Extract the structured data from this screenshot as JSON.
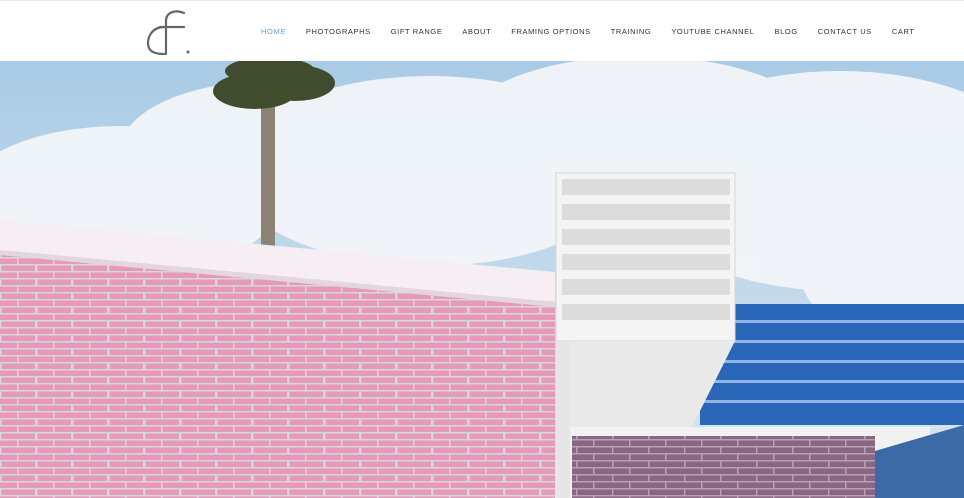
{
  "brand": {
    "logo_text": "cf"
  },
  "nav": {
    "items": [
      {
        "label": "HOME",
        "active": true
      },
      {
        "label": "PHOTOGRAPHS"
      },
      {
        "label": "GIFT RANGE"
      },
      {
        "label": "ABOUT"
      },
      {
        "label": "FRAMING OPTIONS"
      },
      {
        "label": "TRAINING"
      },
      {
        "label": "YOUTUBE CHANNEL"
      },
      {
        "label": "BLOG"
      },
      {
        "label": "CONTACT US"
      },
      {
        "label": "CART"
      }
    ]
  },
  "colors": {
    "nav_active": "#5aa7d1",
    "sky": "#c7dbe9",
    "brick": "#e79ab8",
    "blue_panel": "#2a67b8"
  }
}
